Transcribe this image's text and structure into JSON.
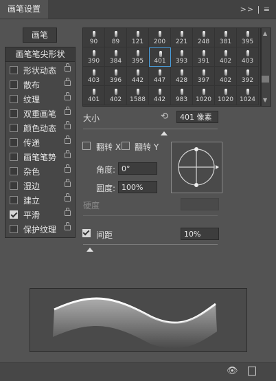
{
  "panel": {
    "tab_label": "画笔设置",
    "menu_icons": ">> | ≡"
  },
  "brush_button": "画笔",
  "left_panel": {
    "header": "画笔笔尖形状",
    "items": [
      {
        "label": "形状动态",
        "checked": false
      },
      {
        "label": "散布",
        "checked": false
      },
      {
        "label": "纹理",
        "checked": false
      },
      {
        "label": "双重画笔",
        "checked": false
      },
      {
        "label": "颜色动态",
        "checked": false
      },
      {
        "label": "传递",
        "checked": false
      },
      {
        "label": "画笔笔势",
        "checked": false
      },
      {
        "label": "杂色",
        "checked": false
      },
      {
        "label": "湿边",
        "checked": false
      },
      {
        "label": "建立",
        "checked": false
      },
      {
        "label": "平滑",
        "checked": true
      },
      {
        "label": "保护纹理",
        "checked": false
      }
    ]
  },
  "brush_grid": {
    "rows": [
      [
        "90",
        "89",
        "121",
        "200",
        "221",
        "248",
        "381",
        "395"
      ],
      [
        "390",
        "384",
        "395",
        "401",
        "393",
        "391",
        "402",
        "403"
      ],
      [
        "403",
        "396",
        "442",
        "447",
        "428",
        "397",
        "402",
        "392"
      ],
      [
        "401",
        "402",
        "1588",
        "442",
        "983",
        "1020",
        "1020",
        "1024"
      ]
    ],
    "selected": "401"
  },
  "size": {
    "label": "大小",
    "value": "401 像素",
    "slider_percent": 60
  },
  "flip": {
    "x_label": "翻转 X",
    "y_label": "翻转 Y"
  },
  "angle": {
    "label": "角度:",
    "value": "0°"
  },
  "roundness": {
    "label": "圆度:",
    "value": "100%"
  },
  "hardness": {
    "label": "硬度",
    "value": ""
  },
  "spacing": {
    "label": "间距",
    "value": "10%",
    "checked": true,
    "slider_percent": 5
  }
}
